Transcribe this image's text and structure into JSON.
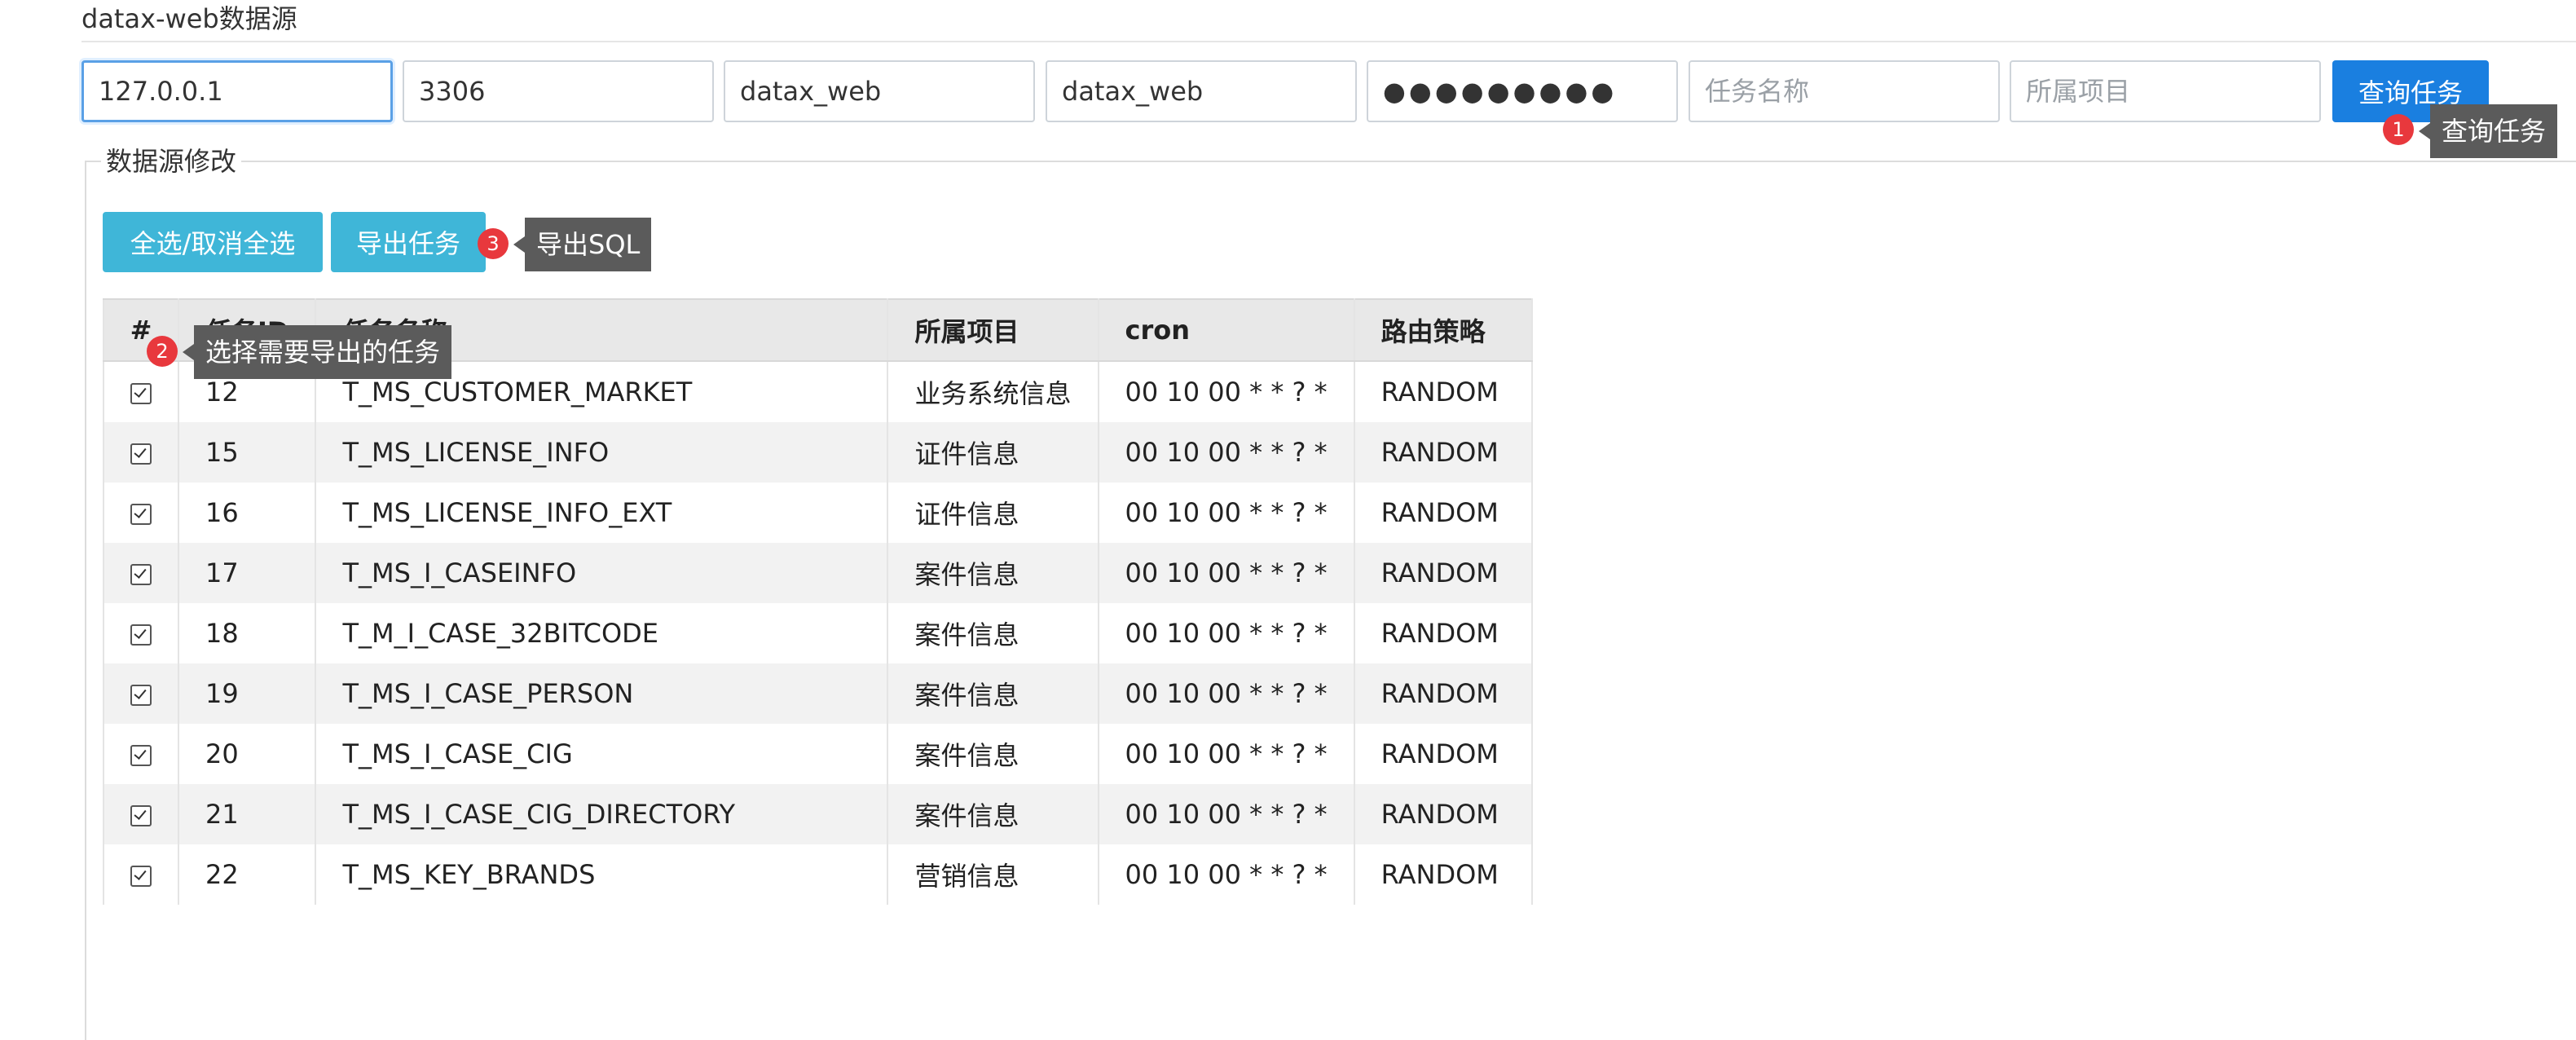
{
  "page": {
    "title": "datax-web数据源"
  },
  "connection": {
    "host": "127.0.0.1",
    "port": "3306",
    "database": "datax_web",
    "username": "datax_web",
    "password": "●●●●●●●●●",
    "task_name_placeholder": "任务名称",
    "project_placeholder": "所属项目",
    "query_button_label": "查询任务"
  },
  "panel": {
    "legend": "数据源修改",
    "select_all_label": "全选/取消全选",
    "export_label": "导出任务"
  },
  "annotations": {
    "step1_number": "1",
    "step1_tip": "查询任务",
    "step2_number": "2",
    "step2_tip": "选择需要导出的任务",
    "step3_number": "3",
    "step3_tip": "导出SQL"
  },
  "table": {
    "headers": [
      "#",
      "任务ID",
      "任务名称",
      "所属项目",
      "cron",
      "路由策略"
    ],
    "rows": [
      {
        "checked": true,
        "id": "12",
        "name": "T_MS_CUSTOMER_MARKET",
        "project": "业务系统信息",
        "cron": "00 10 00 * * ? *",
        "route": "RANDOM"
      },
      {
        "checked": true,
        "id": "15",
        "name": "T_MS_LICENSE_INFO",
        "project": "证件信息",
        "cron": "00 10 00 * * ? *",
        "route": "RANDOM"
      },
      {
        "checked": true,
        "id": "16",
        "name": "T_MS_LICENSE_INFO_EXT",
        "project": "证件信息",
        "cron": "00 10 00 * * ? *",
        "route": "RANDOM"
      },
      {
        "checked": true,
        "id": "17",
        "name": "T_MS_I_CASEINFO",
        "project": "案件信息",
        "cron": "00 10 00 * * ? *",
        "route": "RANDOM"
      },
      {
        "checked": true,
        "id": "18",
        "name": "T_M_I_CASE_32BITCODE",
        "project": "案件信息",
        "cron": "00 10 00 * * ? *",
        "route": "RANDOM"
      },
      {
        "checked": true,
        "id": "19",
        "name": "T_MS_I_CASE_PERSON",
        "project": "案件信息",
        "cron": "00 10 00 * * ? *",
        "route": "RANDOM"
      },
      {
        "checked": true,
        "id": "20",
        "name": "T_MS_I_CASE_CIG",
        "project": "案件信息",
        "cron": "00 10 00 * * ? *",
        "route": "RANDOM"
      },
      {
        "checked": true,
        "id": "21",
        "name": "T_MS_I_CASE_CIG_DIRECTORY",
        "project": "案件信息",
        "cron": "00 10 00 * * ? *",
        "route": "RANDOM"
      },
      {
        "checked": true,
        "id": "22",
        "name": "T_MS_KEY_BRANDS",
        "project": "营销信息",
        "cron": "00 10 00 * * ? *",
        "route": "RANDOM"
      }
    ]
  },
  "colors": {
    "primary": "#1a7fe0",
    "info": "#3fb6d8",
    "badge": "#e8383d",
    "tooltip": "#5b5b5b"
  }
}
